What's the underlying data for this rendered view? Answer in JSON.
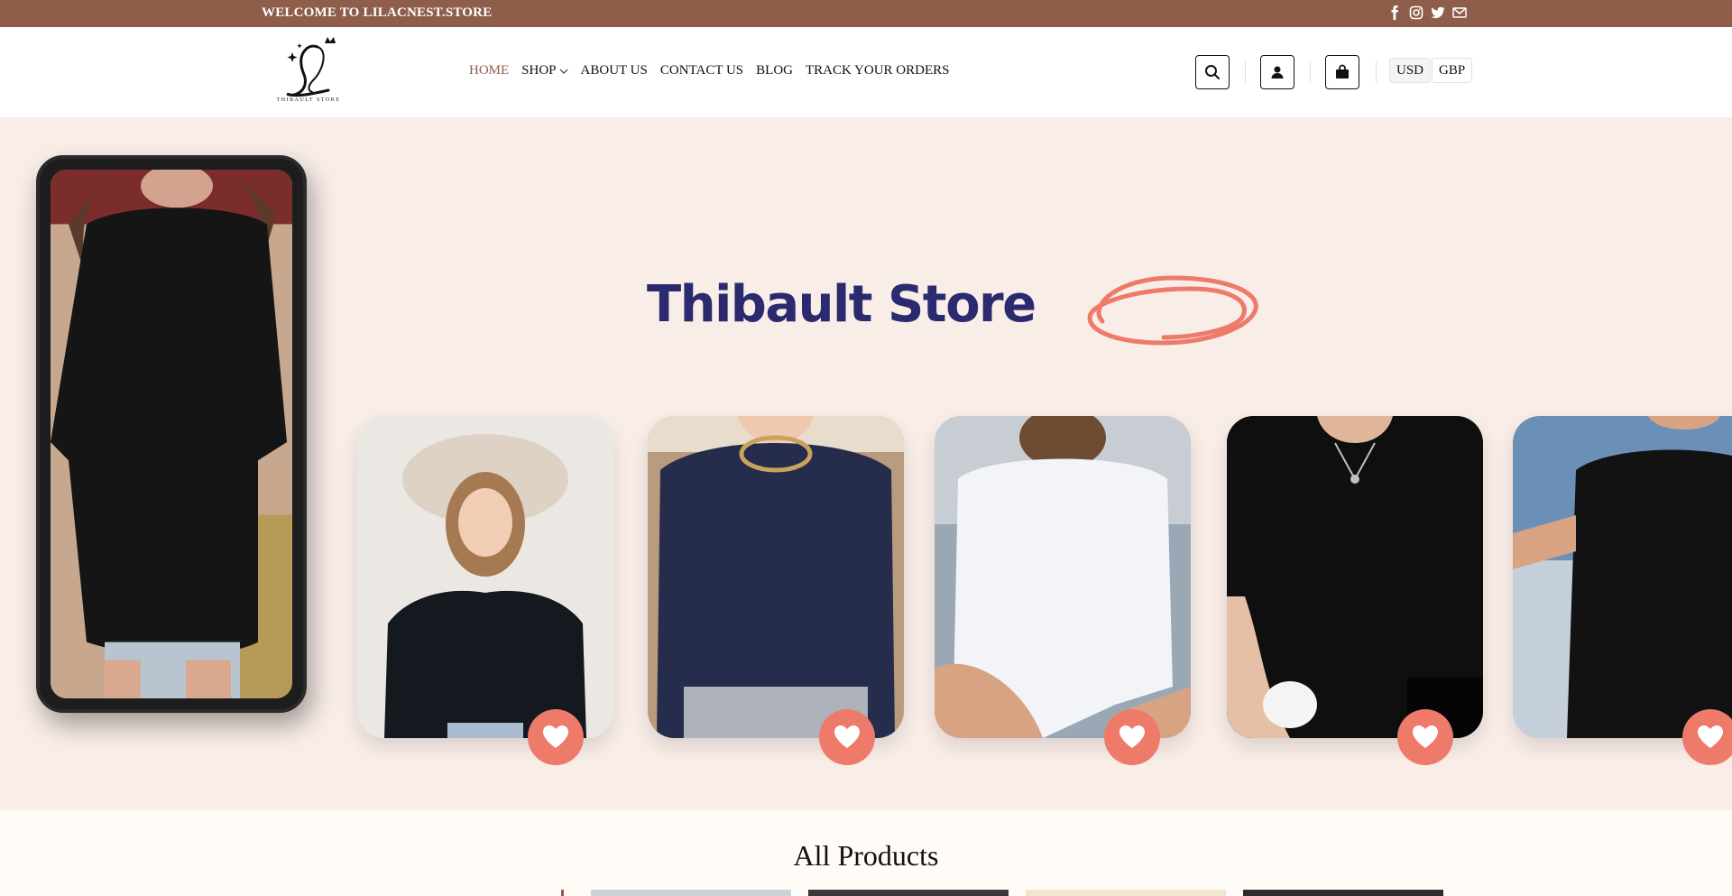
{
  "topbar": {
    "welcome": "WELCOME TO LILACNEST.STORE",
    "social_icons": [
      "facebook-icon",
      "instagram-icon",
      "twitter-icon",
      "email-icon"
    ],
    "bg_color": "#8e5e4b"
  },
  "header": {
    "logo_text": "THIBAULT STORE",
    "nav": [
      {
        "label": "HOME",
        "active": true
      },
      {
        "label": "SHOP",
        "dropdown": true
      },
      {
        "label": "ABOUT US"
      },
      {
        "label": "CONTACT US"
      },
      {
        "label": "BLOG"
      },
      {
        "label": "TRACK YOUR ORDERS"
      }
    ],
    "icons": [
      "search-icon",
      "account-icon",
      "cart-icon"
    ],
    "currencies": [
      "USD",
      "GBP"
    ]
  },
  "hero": {
    "brand_title": "Thibault Store",
    "bg_color": "#f9ede8",
    "accent_color": "#ee7a6a",
    "products": [
      {
        "name": "black-sweatshirt"
      },
      {
        "name": "navy-sweatshirt"
      },
      {
        "name": "white-oversized-tee"
      },
      {
        "name": "black-oversized-tee"
      },
      {
        "name": "black-tee-partial"
      }
    ]
  },
  "products_section": {
    "title": "All Products"
  }
}
